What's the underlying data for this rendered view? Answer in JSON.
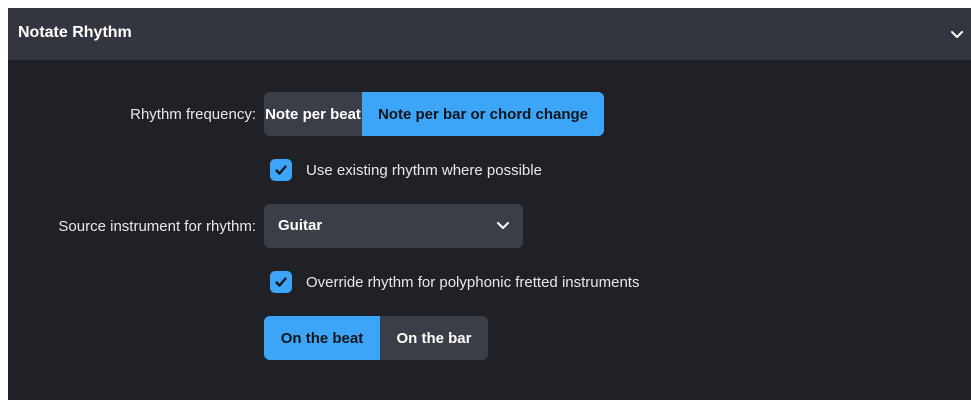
{
  "panel": {
    "title": "Notate Rhythm"
  },
  "rhythm_frequency": {
    "label": "Rhythm frequency:",
    "options": [
      "Note per beat",
      "Note per bar or chord change"
    ],
    "selected": "Note per bar or chord change"
  },
  "use_existing_rhythm": {
    "label": "Use existing rhythm where possible",
    "checked": true
  },
  "source_instrument": {
    "label": "Source instrument for rhythm:",
    "value": "Guitar"
  },
  "override_rhythm": {
    "label": "Override rhythm for polyphonic fretted instruments",
    "checked": true
  },
  "override_mode": {
    "options": [
      "On the beat",
      "On the bar"
    ],
    "selected": "On the beat"
  },
  "colors": {
    "accent": "#3da5f7",
    "panel_bg": "#1f2126",
    "header_bg": "#33363e",
    "control_bg": "#3a3e47"
  },
  "icons": {
    "collapse": "chevron-down-icon",
    "checkbox": "check-icon",
    "dropdown": "chevron-down-icon"
  }
}
